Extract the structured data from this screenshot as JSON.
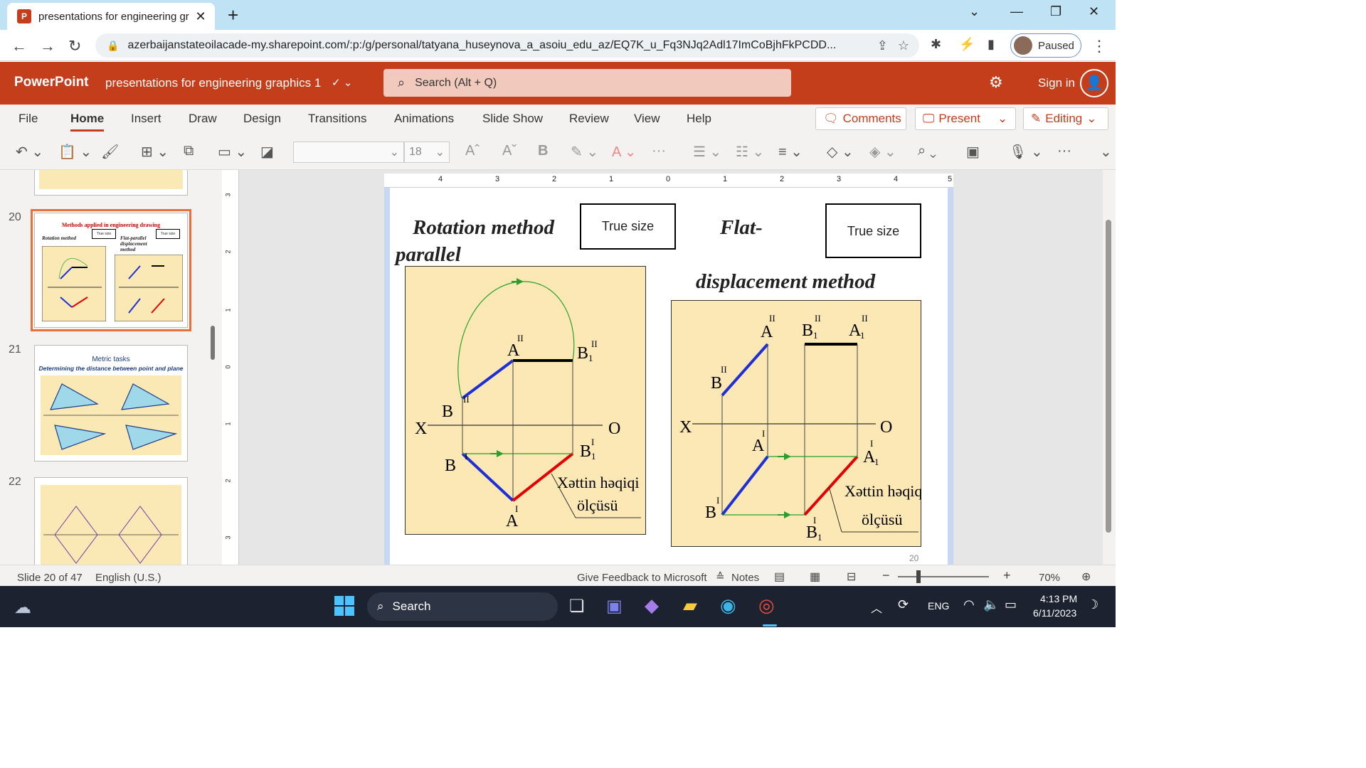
{
  "browser": {
    "tab_title": "presentations for engineering gr",
    "tab_icon": "P",
    "url": "azerbaijanstateoilacade-my.sharepoint.com/:p:/g/personal/tatyana_huseynova_a_asoiu_edu_az/EQ7K_u_Fq3NJq2Adl17ImCoBjhFkPCDD...",
    "profile_label": "Paused"
  },
  "app": {
    "brand": "PowerPoint",
    "doc_title": "presentations for engineering graphics 1",
    "search_placeholder": "Search (Alt + Q)",
    "sign_in": "Sign in",
    "accent": "#c43e1c"
  },
  "menu": {
    "items": [
      "File",
      "Home",
      "Insert",
      "Draw",
      "Design",
      "Transitions",
      "Animations",
      "Slide Show",
      "Review",
      "View",
      "Help"
    ],
    "comments": "Comments",
    "present": "Present",
    "editing": "Editing"
  },
  "toolbar": {
    "font_size": "18"
  },
  "thumbnails": [
    {
      "num": "20",
      "title": "Methods applied in engineering drawing",
      "true_size": "True size",
      "left_caption": "Rotation method",
      "right_caption": "Flat-parallel displacement method"
    },
    {
      "num": "21",
      "title": "Metric tasks",
      "subtitle": "Determining the distance between point and plane"
    },
    {
      "num": "22"
    }
  ],
  "ruler": {
    "h_labels": [
      "4",
      "3",
      "2",
      "1",
      "0",
      "1",
      "2",
      "3",
      "4",
      "5"
    ],
    "v_labels": [
      "3",
      "2",
      "1",
      "0",
      "1",
      "2",
      "3"
    ]
  },
  "slide": {
    "title_left": "Rotation method",
    "title_left2": "parallel",
    "title_right": "Flat-",
    "title_right2": "displacement method",
    "true_size_left": "True size",
    "true_size_right": "True size",
    "page_number": "20",
    "left": {
      "x": "X",
      "o": "O",
      "a2": "A",
      "b2": "B",
      "b12": "B",
      "b12sub": "1",
      "a1": "A",
      "b1": "B",
      "b11": "B",
      "b11sub": "1",
      "caption1": "Xəttin həqiqi",
      "caption2": "ölçüsü"
    },
    "right": {
      "x": "X",
      "o": "O",
      "a2": "A",
      "b2": "B",
      "b12": "B",
      "a12": "A",
      "sub": "1",
      "a1": "A",
      "b1": "B",
      "a11": "A",
      "b11": "B",
      "caption1": "Xəttin həqiqi",
      "caption2": "ölçüsü"
    }
  },
  "status": {
    "slide_info": "Slide 20 of 47",
    "language": "English (U.S.)",
    "feedback": "Give Feedback to Microsoft",
    "notes": "Notes",
    "zoom": "70%"
  },
  "taskbar": {
    "search": "Search",
    "lang": "ENG",
    "time": "4:13 PM",
    "date": "6/11/2023"
  }
}
